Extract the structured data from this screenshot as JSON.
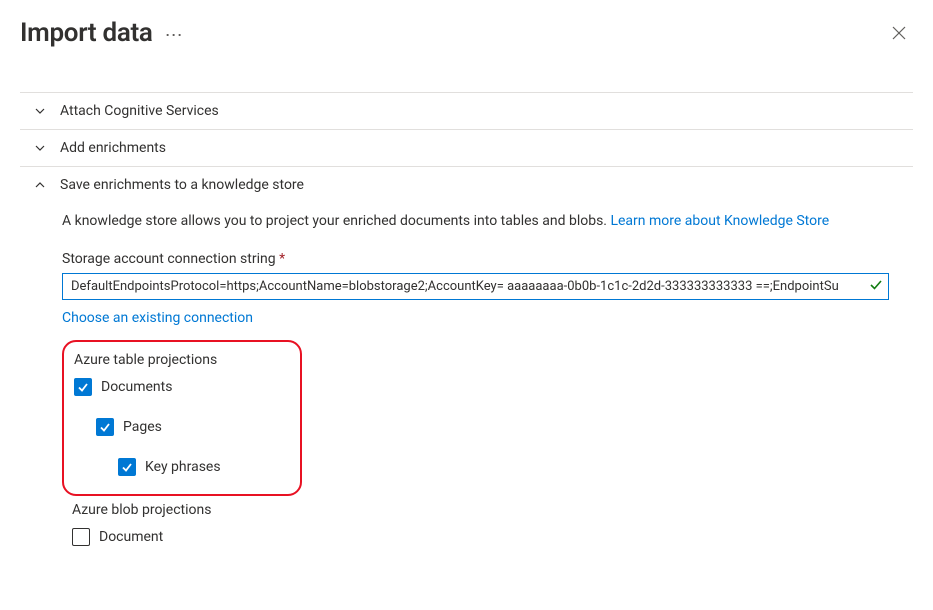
{
  "header": {
    "title": "Import data"
  },
  "sections": {
    "attach": {
      "label": "Attach Cognitive Services"
    },
    "enrich": {
      "label": "Add enrichments"
    },
    "save": {
      "label": "Save enrichments to a knowledge store",
      "description_prefix": "A knowledge store allows you to project your enriched documents into tables and blobs. ",
      "learn_more": "Learn more about Knowledge Store",
      "conn_label": "Storage account connection string",
      "conn_value": "DefaultEndpointsProtocol=https;AccountName=blobstorage2;AccountKey= aaaaaaaa-0b0b-1c1c-2d2d-333333333333 ==;EndpointSu",
      "choose_existing": "Choose an existing connection",
      "table_projections": {
        "title": "Azure table projections",
        "items": [
          {
            "label": "Documents",
            "checked": true,
            "indent": 0
          },
          {
            "label": "Pages",
            "checked": true,
            "indent": 1
          },
          {
            "label": "Key phrases",
            "checked": true,
            "indent": 2
          }
        ]
      },
      "blob_projections": {
        "title": "Azure blob projections",
        "items": [
          {
            "label": "Document",
            "checked": false,
            "indent": 0
          }
        ]
      }
    }
  }
}
